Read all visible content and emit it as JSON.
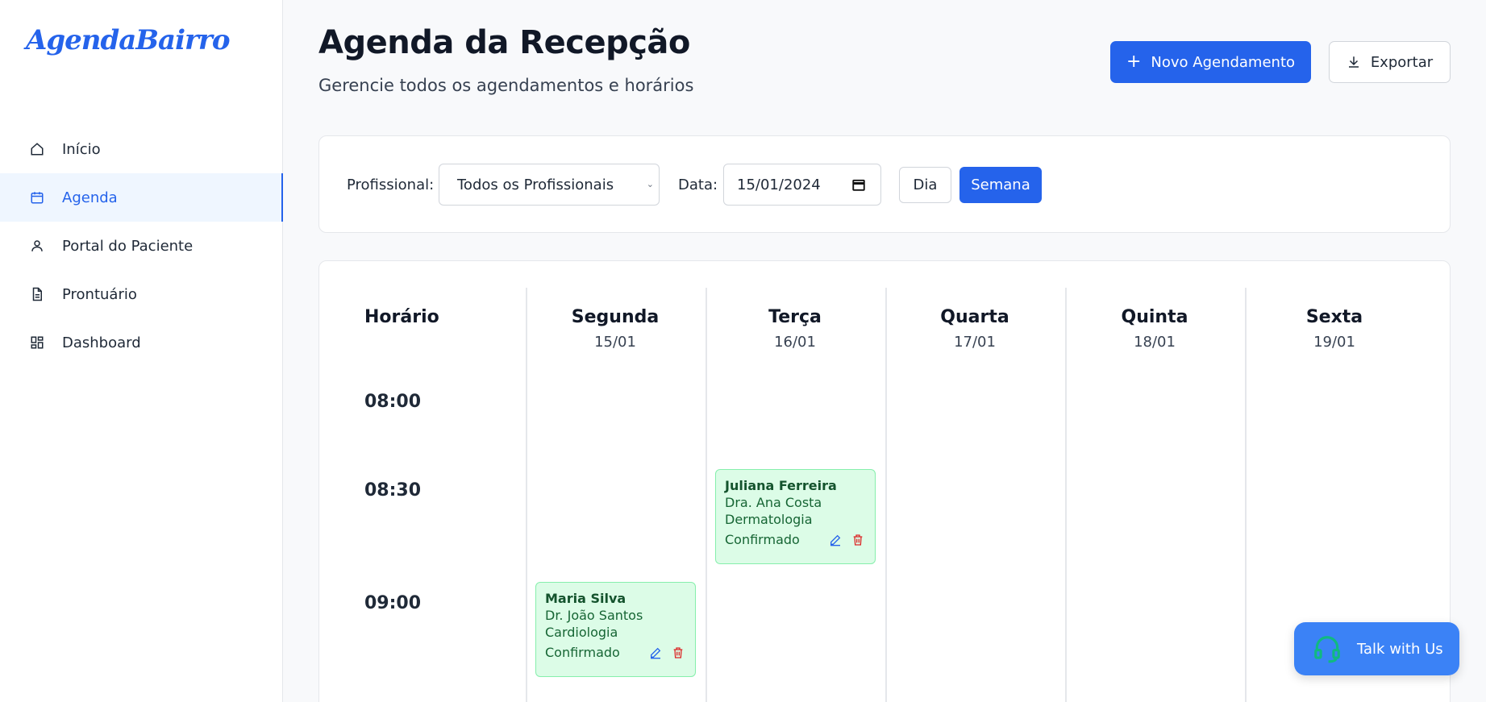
{
  "app": {
    "logo": "AgendaBairro"
  },
  "sidebar": {
    "items": [
      {
        "label": "Início",
        "icon": "home-icon",
        "active": false
      },
      {
        "label": "Agenda",
        "icon": "calendar-icon",
        "active": true
      },
      {
        "label": "Portal do Paciente",
        "icon": "user-icon",
        "active": false
      },
      {
        "label": "Prontuário",
        "icon": "document-icon",
        "active": false
      },
      {
        "label": "Dashboard",
        "icon": "dashboard-icon",
        "active": false
      }
    ]
  },
  "header": {
    "title": "Agenda da Recepção",
    "subtitle": "Gerencie todos os agendamentos e horários",
    "new_label": "Novo Agendamento",
    "export_label": "Exportar"
  },
  "filters": {
    "professional_label": "Profissional:",
    "professional_value": "Todos os Profissionais",
    "date_label": "Data:",
    "date_value": "15/01/2024",
    "view_day": "Dia",
    "view_week": "Semana",
    "active_view": "Semana"
  },
  "calendar": {
    "time_header": "Horário",
    "days": [
      {
        "name": "Segunda",
        "date": "15/01"
      },
      {
        "name": "Terça",
        "date": "16/01"
      },
      {
        "name": "Quarta",
        "date": "17/01"
      },
      {
        "name": "Quinta",
        "date": "18/01"
      },
      {
        "name": "Sexta",
        "date": "19/01"
      }
    ],
    "times": [
      "08:00",
      "08:30",
      "09:00"
    ],
    "appointments": [
      {
        "patient": "Juliana Ferreira",
        "doctor": "Dra. Ana Costa",
        "specialty": "Dermatologia",
        "status": "Confirmado",
        "day": "Terça",
        "time": "08:30"
      },
      {
        "patient": "Maria Silva",
        "doctor": "Dr. João Santos",
        "specialty": "Cardiologia",
        "status": "Confirmado",
        "day": "Segunda",
        "time": "09:00"
      }
    ]
  },
  "chat": {
    "label": "Talk with Us"
  },
  "colors": {
    "primary": "#2563eb",
    "appointment_bg": "#dcfce7",
    "appointment_border": "#86efac",
    "delete": "#dc2626"
  }
}
